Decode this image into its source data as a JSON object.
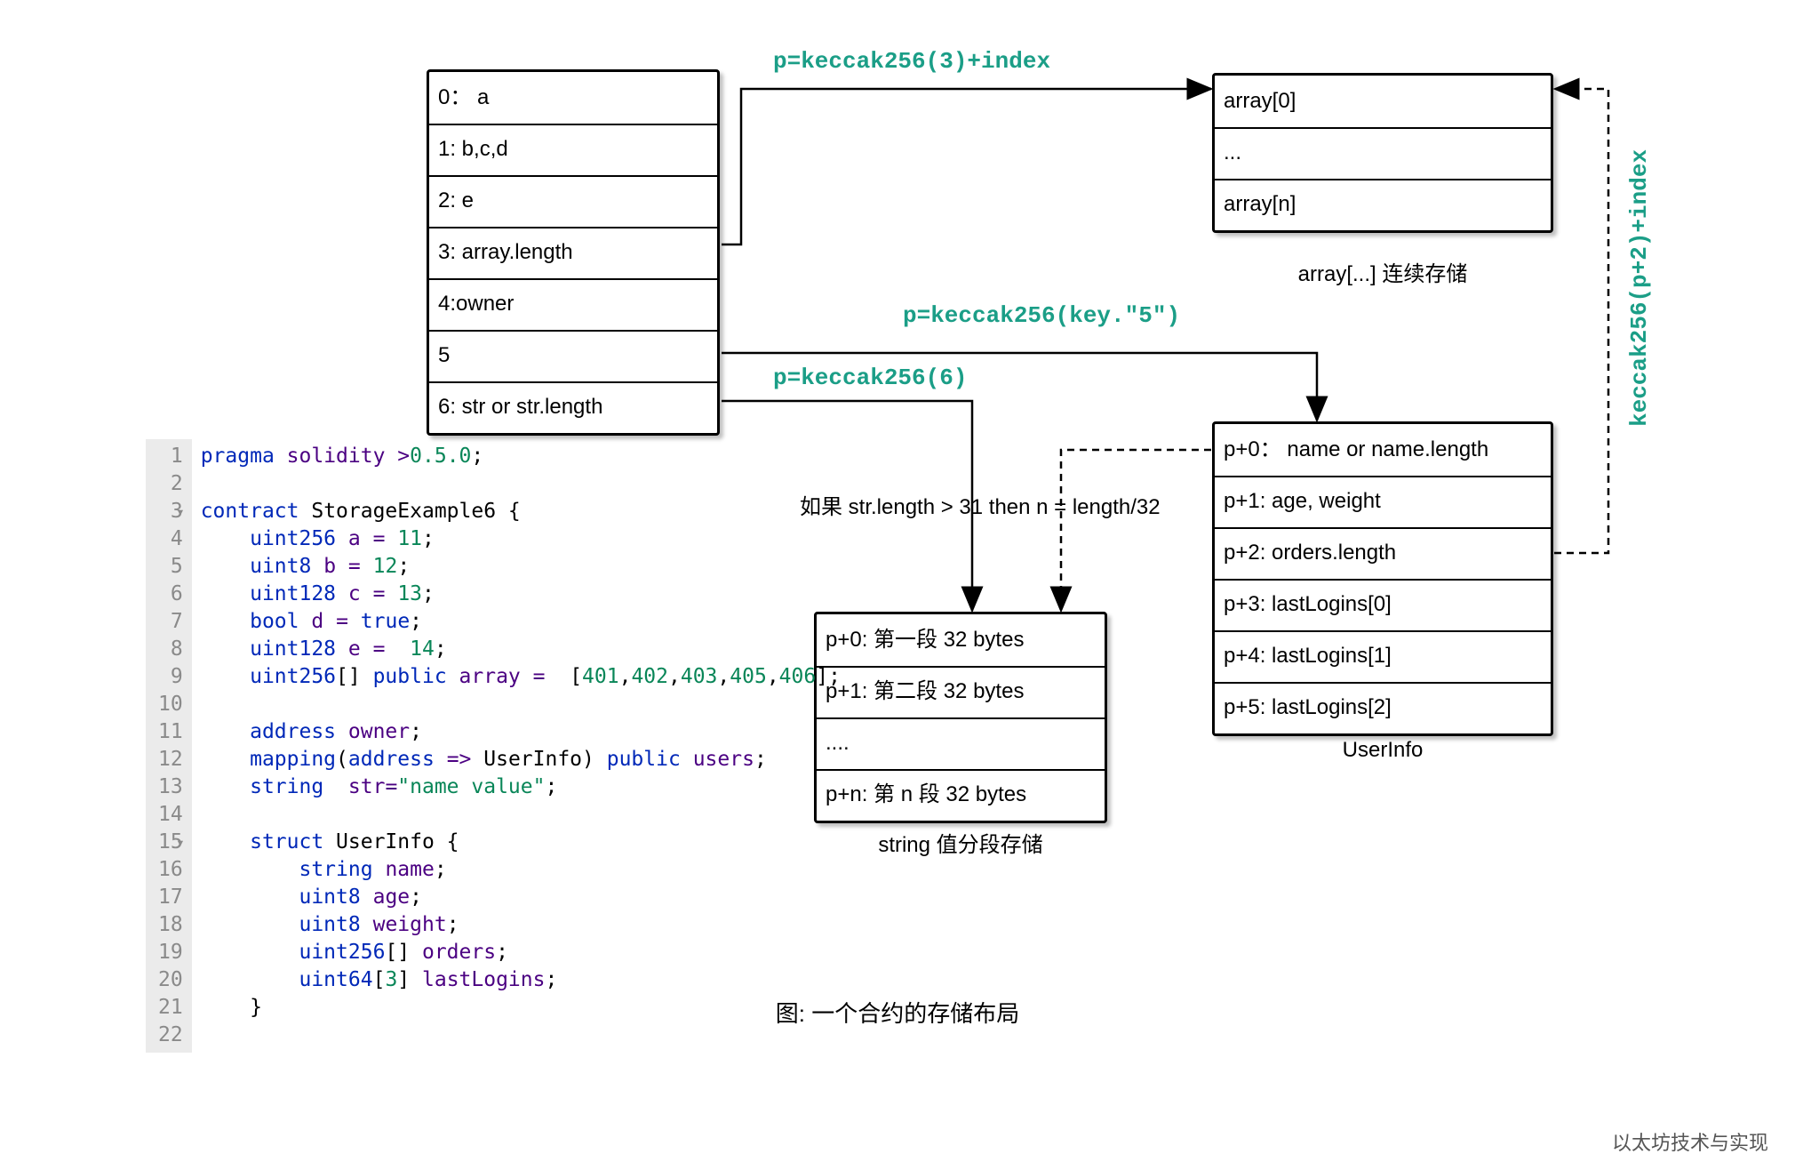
{
  "slotBox": {
    "cells": [
      "0： a",
      "1:  b,c,d",
      "2: e",
      "3: array.length",
      "4:owner",
      "5",
      "6: str or str.length"
    ]
  },
  "arrayBox": {
    "cells": [
      "array[0]",
      "...",
      "array[n]"
    ],
    "caption": "array[...] 连续存储"
  },
  "stringBox": {
    "cells": [
      "p+0:  第一段 32 bytes",
      "p+1:  第二段 32 bytes",
      "....",
      "p+n:  第 n  段 32 bytes"
    ],
    "caption": "string 值分段存储"
  },
  "userInfoBox": {
    "cells": [
      "p+0： name or name.length",
      "p+1: age, weight",
      "p+2: orders.length",
      "p+3: lastLogins[0]",
      "p+4: lastLogins[1]",
      "p+5: lastLogins[2]"
    ],
    "caption": "UserInfo"
  },
  "formulas": {
    "arrayPtr": "p=keccak256(3)+index",
    "mapPtr": "p=keccak256(key.\"5\")",
    "strPtr": "p=keccak256(6)",
    "ordersPtr": "keccak256(p+2)+index"
  },
  "notes": {
    "strCond": "如果 str.length > 31 then n = length/32"
  },
  "code": {
    "lines": [
      {
        "n": 1,
        "html": "<span class='kw'>pragma</span> <span class='func'>solidity</span> <span class='op'>&gt;</span><span class='num'>0.5.0</span>;"
      },
      {
        "n": 2,
        "html": ""
      },
      {
        "n": 3,
        "arrow": true,
        "html": "<span class='kw'>contract</span> <span class='ident'>StorageExample6</span> {"
      },
      {
        "n": 4,
        "html": "    <span class='kw'>uint256</span> <span class='func'>a</span> <span class='op'>=</span> <span class='num'>11</span>;"
      },
      {
        "n": 5,
        "html": "    <span class='kw'>uint8</span> <span class='func'>b</span> <span class='op'>=</span> <span class='num'>12</span>;"
      },
      {
        "n": 6,
        "html": "    <span class='kw'>uint128</span> <span class='func'>c</span> <span class='op'>=</span> <span class='num'>13</span>;"
      },
      {
        "n": 7,
        "html": "    <span class='kw'>bool</span> <span class='func'>d</span> <span class='op'>=</span> <span class='bool'>true</span>;"
      },
      {
        "n": 8,
        "html": "    <span class='kw'>uint128</span> <span class='func'>e</span> <span class='op'>=</span>  <span class='num'>14</span>;"
      },
      {
        "n": 9,
        "html": "    <span class='kw'>uint256</span>[] <span class='kw'>public</span> <span class='func'>array</span> <span class='op'>=</span>  [<span class='num'>401</span>,<span class='num'>402</span>,<span class='num'>403</span>,<span class='num'>405</span>,<span class='num'>406</span>];"
      },
      {
        "n": 10,
        "html": ""
      },
      {
        "n": 11,
        "html": "    <span class='kw'>address</span> <span class='func'>owner</span>;"
      },
      {
        "n": 12,
        "html": "    <span class='kw'>mapping</span>(<span class='kw'>address</span> <span class='op'>=&gt;</span> <span class='ident'>UserInfo</span>) <span class='kw'>public</span> <span class='func'>users</span>;"
      },
      {
        "n": 13,
        "html": "    <span class='kw'>string</span>  <span class='func'>str</span><span class='op'>=</span><span class='str'>\"name value\"</span>;"
      },
      {
        "n": 14,
        "html": ""
      },
      {
        "n": 15,
        "arrow": true,
        "html": "    <span class='kw'>struct</span> <span class='ident'>UserInfo</span> {"
      },
      {
        "n": 16,
        "html": "        <span class='kw'>string</span> <span class='func'>name</span>;"
      },
      {
        "n": 17,
        "html": "        <span class='kw'>uint8</span> <span class='func'>age</span>;"
      },
      {
        "n": 18,
        "html": "        <span class='kw'>uint8</span> <span class='func'>weight</span>;"
      },
      {
        "n": 19,
        "html": "        <span class='kw'>uint256</span>[] <span class='func'>orders</span>;"
      },
      {
        "n": 20,
        "html": "        <span class='kw'>uint64</span>[<span class='num'>3</span>] <span class='func'>lastLogins</span>;"
      },
      {
        "n": 21,
        "html": "    }"
      },
      {
        "n": 22,
        "html": ""
      }
    ]
  },
  "figureCaption": "图:   一个合约的存储布局",
  "footer": "以太坊技术与实现"
}
